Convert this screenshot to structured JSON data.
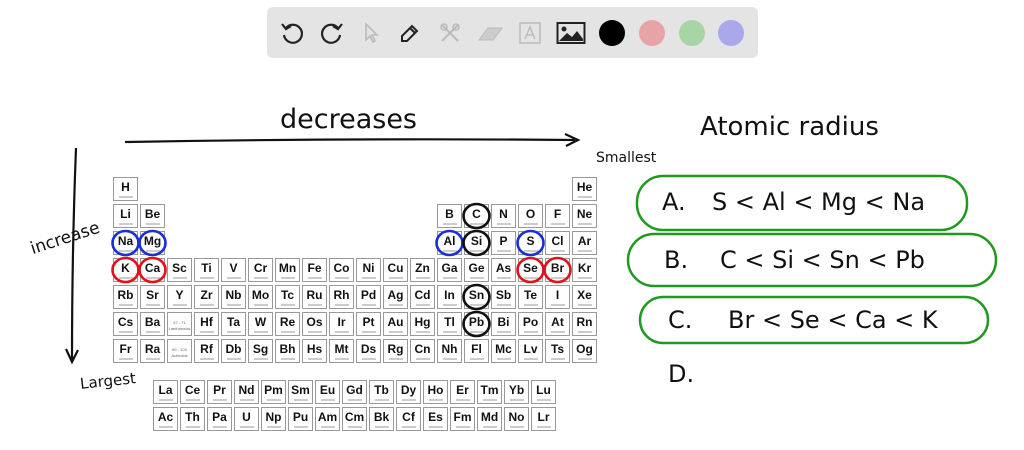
{
  "toolbar": {
    "tools": [
      "undo-icon",
      "redo-icon",
      "select-icon",
      "pen-icon",
      "tools-icon",
      "eraser-icon",
      "text-icon",
      "image-icon"
    ],
    "colors": [
      "#000000",
      "#e8a3a8",
      "#a9d4a6",
      "#aaa7ea"
    ]
  },
  "periodic_table": {
    "rows": [
      [
        "H",
        "",
        "",
        "",
        "",
        "",
        "",
        "",
        "",
        "",
        "",
        "",
        "",
        "",
        "",
        "",
        "",
        "He"
      ],
      [
        "Li",
        "Be",
        "",
        "",
        "",
        "",
        "",
        "",
        "",
        "",
        "",
        "",
        "B",
        "C",
        "N",
        "O",
        "F",
        "Ne"
      ],
      [
        "Na",
        "Mg",
        "",
        "",
        "",
        "",
        "",
        "",
        "",
        "",
        "",
        "",
        "Al",
        "Si",
        "P",
        "S",
        "Cl",
        "Ar"
      ],
      [
        "K",
        "Ca",
        "Sc",
        "Ti",
        "V",
        "Cr",
        "Mn",
        "Fe",
        "Co",
        "Ni",
        "Cu",
        "Zn",
        "Ga",
        "Ge",
        "As",
        "Se",
        "Br",
        "Kr"
      ],
      [
        "Rb",
        "Sr",
        "Y",
        "Zr",
        "Nb",
        "Mo",
        "Tc",
        "Ru",
        "Rh",
        "Pd",
        "Ag",
        "Cd",
        "In",
        "Sn",
        "Sb",
        "Te",
        "I",
        "Xe"
      ],
      [
        "Cs",
        "Ba",
        "57 - 71 Lanthanoids",
        "Hf",
        "Ta",
        "W",
        "Re",
        "Os",
        "Ir",
        "Pt",
        "Au",
        "Hg",
        "Tl",
        "Pb",
        "Bi",
        "Po",
        "At",
        "Rn"
      ],
      [
        "Fr",
        "Ra",
        "89 - 103 Actinoids",
        "Rf",
        "Db",
        "Sg",
        "Bh",
        "Hs",
        "Mt",
        "Ds",
        "Rg",
        "Cn",
        "Nh",
        "Fl",
        "Mc",
        "Lv",
        "Ts",
        "Og"
      ]
    ],
    "f_block": [
      [
        "La",
        "Ce",
        "Pr",
        "Nd",
        "Pm",
        "Sm",
        "Eu",
        "Gd",
        "Tb",
        "Dy",
        "Ho",
        "Er",
        "Tm",
        "Yb",
        "Lu"
      ],
      [
        "Ac",
        "Th",
        "Pa",
        "U",
        "Np",
        "Pu",
        "Am",
        "Cm",
        "Bk",
        "Cf",
        "Es",
        "Fm",
        "Md",
        "No",
        "Lr"
      ]
    ],
    "circled": {
      "blue": [
        "Na",
        "Mg",
        "Al",
        "S"
      ],
      "red": [
        "K",
        "Ca",
        "Se",
        "Br"
      ],
      "black": [
        "C",
        "Si",
        "Sn",
        "Pb"
      ]
    }
  },
  "notes": {
    "top_arrow": "decreases",
    "left_arrow": "increase",
    "smallest": "Smallest",
    "largest": "Largest",
    "title": "Atomic radius",
    "answers": [
      {
        "label": "A.",
        "text": "S < Al < Mg < Na"
      },
      {
        "label": "B.",
        "text": "C < Si < Sn < Pb"
      },
      {
        "label": "C.",
        "text": "Br < Se < Ca < K"
      },
      {
        "label": "D.",
        "text": ""
      }
    ]
  },
  "colors": {
    "blue": "#1a2fd6",
    "red": "#e0121c",
    "black": "#111111",
    "green": "#1f9a1f"
  }
}
